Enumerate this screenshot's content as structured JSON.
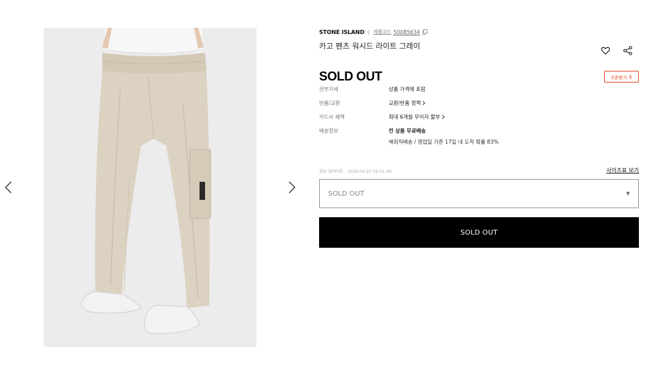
{
  "gallery": {
    "prev_icon": "chevron-left-icon",
    "next_icon": "chevron-right-icon",
    "image_alt": "product-photo-pants"
  },
  "product": {
    "brand": "STONE ISLAND",
    "code_label": "제품코드",
    "code_value": "50085634",
    "name": "카고 팬츠 워시드 라이트 그레이",
    "status_title": "SOLD OUT",
    "coupon_label": "쿠폰받기",
    "specs": [
      {
        "label": "관부가세",
        "value": "상품 가격에 포함"
      },
      {
        "label": "반품/교환",
        "value": "교환/반품 정책"
      },
      {
        "label": "카드사 혜택",
        "value": "최대 6개월 무이자 할부"
      },
      {
        "label": "배송정보",
        "value": "전 상품 무료배송"
      }
    ],
    "shipping_detail": "해외직배송 / 영업일 기준 17일 내 도착 확률 83%",
    "update_time": "정보 업데이트 : 2026.04.20 16:01:46",
    "size_guide": "사이즈표 보기",
    "option_select": "SOLD OUT",
    "cta_label": "SOLD OUT"
  },
  "colors": {
    "accent": "#e24a2a",
    "cta_bg": "#000000",
    "photo_bg": "#ececec"
  }
}
